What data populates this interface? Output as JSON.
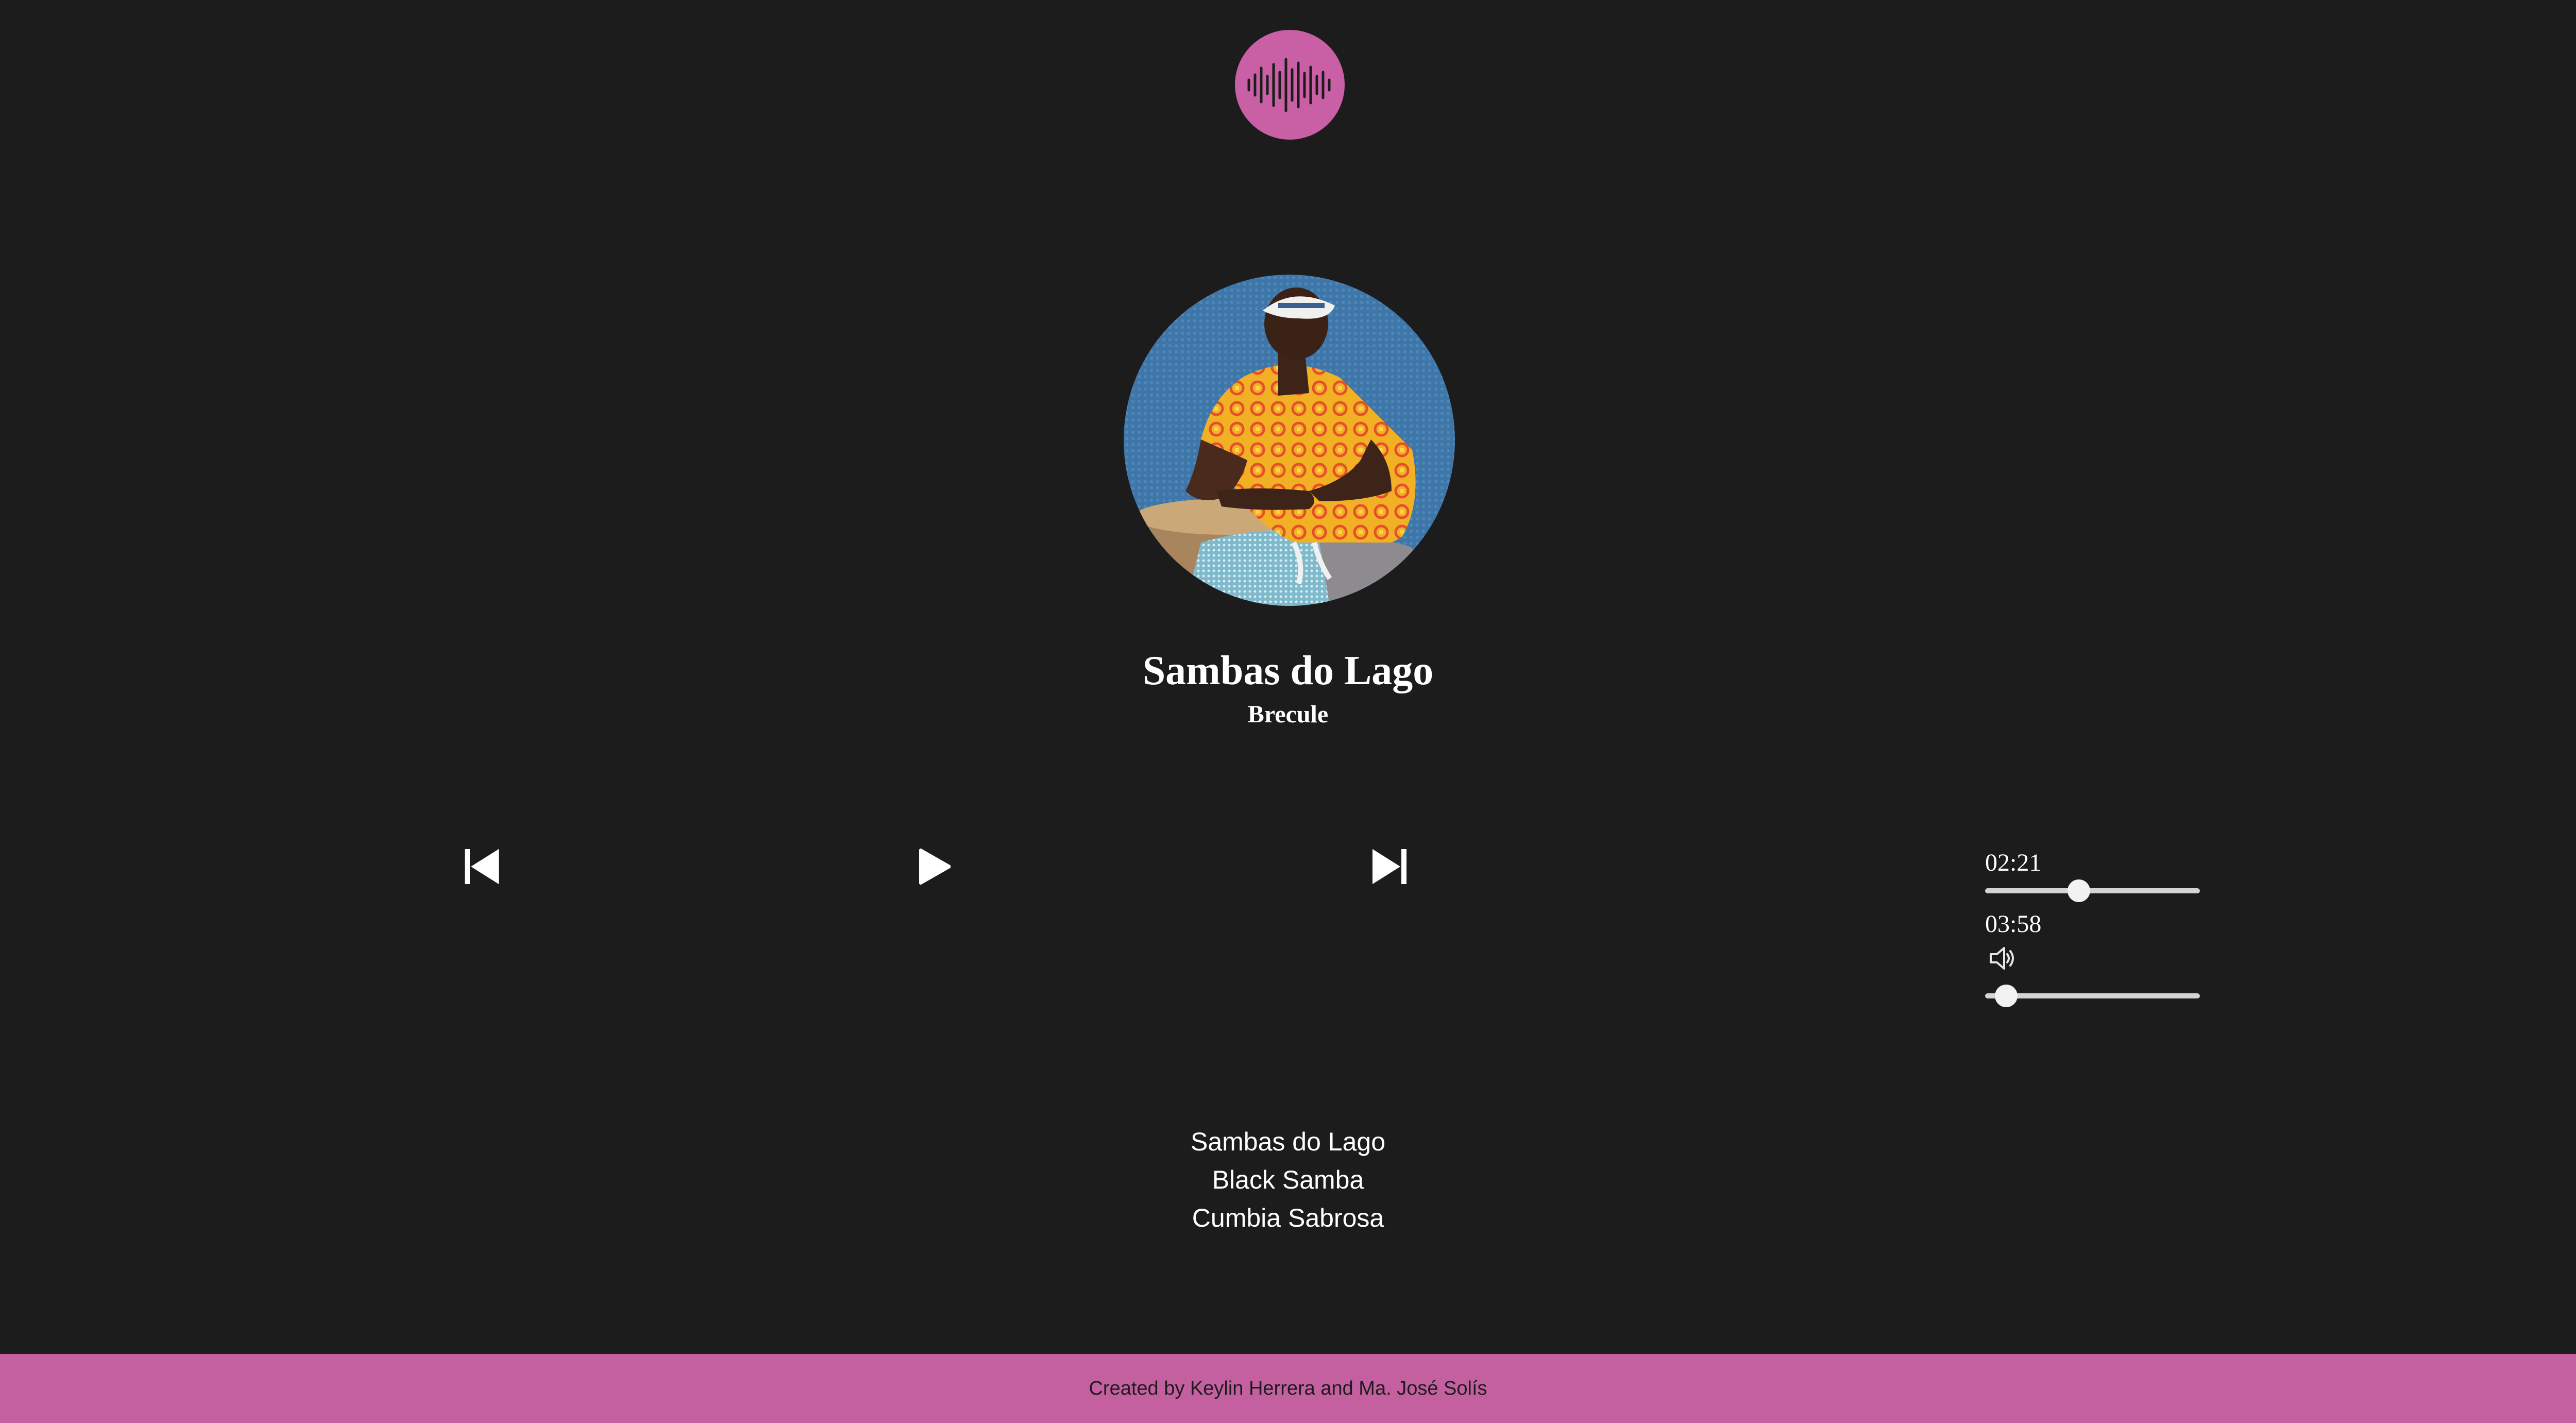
{
  "app": {
    "logo_icon": "soundwave-icon",
    "accent_color": "#c95fa5",
    "background_color": "#1c1c1d"
  },
  "now_playing": {
    "title": "Sambas do Lago",
    "artist": "Brecule"
  },
  "controls": {
    "previous_icon": "skip-previous-icon",
    "play_icon": "play-icon",
    "next_icon": "skip-next-icon"
  },
  "progress": {
    "current_time": "02:21",
    "duration": "03:58",
    "fraction": 0.43
  },
  "volume": {
    "icon": "speaker-icon",
    "fraction": 0.05
  },
  "playlist": [
    "Sambas do Lago",
    "Black Samba",
    "Cumbia Sabrosa"
  ],
  "footer": {
    "credits": "Created by Keylin Herrera and Ma. José Solís"
  }
}
